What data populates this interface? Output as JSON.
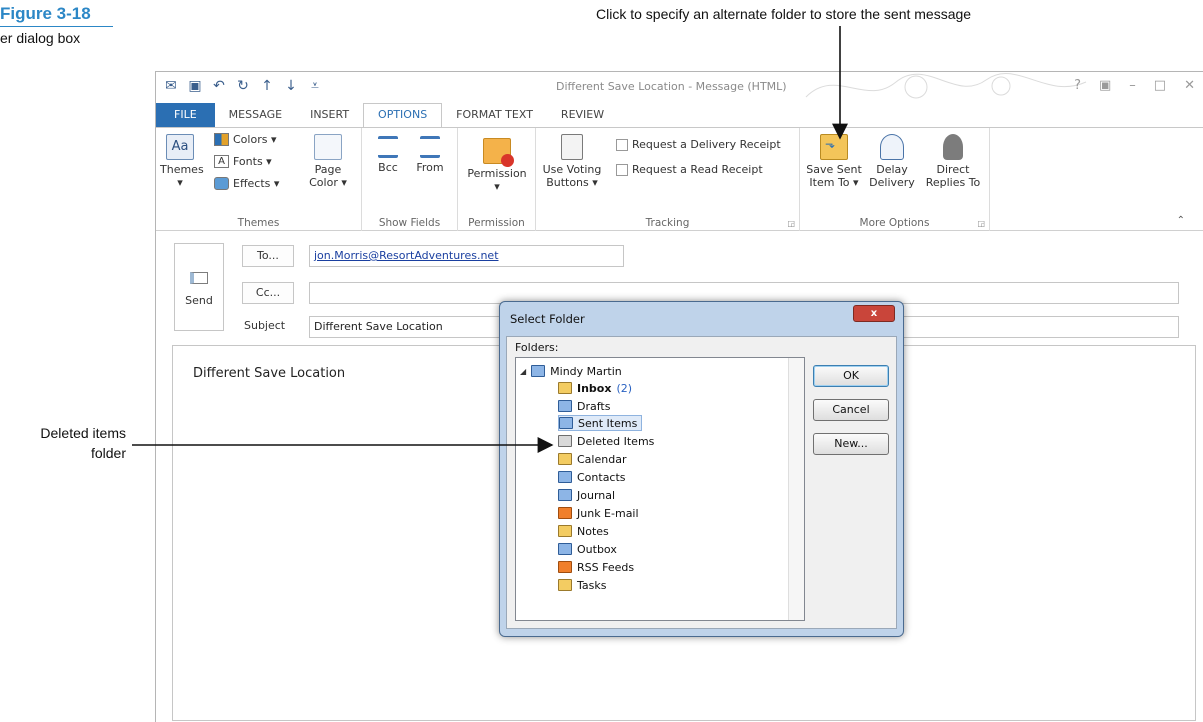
{
  "figure": {
    "number": "Figure 3-18",
    "subtitle": "er dialog box",
    "callout_top": "Click to specify an alternate folder to store the sent message",
    "callout_left_line1": "Deleted items",
    "callout_left_line2": "folder"
  },
  "window": {
    "title": "Different Save Location - Message (HTML)",
    "controls": [
      "?",
      "▣",
      "–",
      "□",
      "✕"
    ]
  },
  "tabs": [
    "FILE",
    "MESSAGE",
    "INSERT",
    "OPTIONS",
    "FORMAT TEXT",
    "REVIEW"
  ],
  "active_tab": "OPTIONS",
  "ribbon": {
    "themes": {
      "themes_label": "Themes",
      "colors": "Colors ▾",
      "fonts": "Fonts ▾",
      "effects": "Effects ▾",
      "page_color_1": "Page",
      "page_color_2": "Color ▾",
      "group": "Themes"
    },
    "show_fields": {
      "bcc": "Bcc",
      "from": "From",
      "group": "Show Fields"
    },
    "permission": {
      "label": "Permission",
      "group": "Permission"
    },
    "tracking": {
      "voting_1": "Use Voting",
      "voting_2": "Buttons ▾",
      "delivery": "Request a Delivery Receipt",
      "read": "Request a Read Receipt",
      "group": "Tracking"
    },
    "more_options": {
      "save_sent_1": "Save Sent",
      "save_sent_2": "Item To ▾",
      "delay_1": "Delay",
      "delay_2": "Delivery",
      "direct_1": "Direct",
      "direct_2": "Replies To",
      "group": "More Options"
    }
  },
  "compose": {
    "send": "Send",
    "to_btn": "To...",
    "cc_btn": "Cc...",
    "to_value": "jon.Morris@ResortAdventures.net",
    "cc_value": "",
    "subject_label": "Subject",
    "subject_value": "Different Save Location",
    "body": "Different Save Location"
  },
  "dialog": {
    "title": "Select Folder",
    "close": "x",
    "folders_label": "Folders:",
    "root": "Mindy Martin",
    "inbox": "Inbox",
    "inbox_count": "(2)",
    "folders": [
      "Drafts",
      "Sent Items",
      "Deleted Items",
      "Calendar",
      "Contacts",
      "Journal",
      "Junk E-mail",
      "Notes",
      "Outbox",
      "RSS Feeds",
      "Tasks"
    ],
    "ok": "OK",
    "cancel": "Cancel",
    "new": "New..."
  }
}
